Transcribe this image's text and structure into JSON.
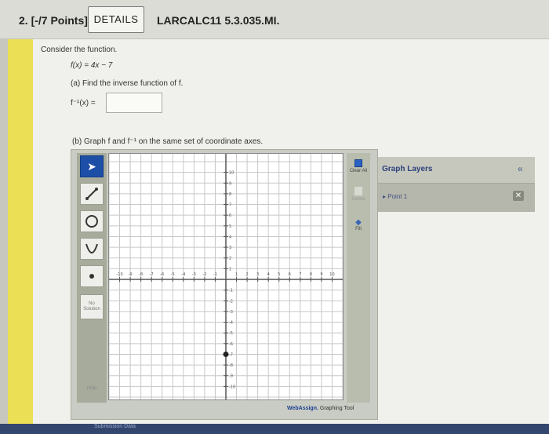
{
  "header": {
    "question_number": "2. [-/7 Points]",
    "details_label": "DETAILS",
    "problem_id": "LARCALC11 5.3.035.MI."
  },
  "problem": {
    "intro": "Consider the function.",
    "function": "f(x) = 4x − 7",
    "part_a": "(a) Find the inverse function of f.",
    "inverse_label": "f⁻¹(x) =",
    "inverse_value": "",
    "part_b": "(b) Graph f and f⁻¹ on the same set of coordinate axes."
  },
  "graph_tool": {
    "tools": [
      {
        "name": "pointer-tool",
        "icon": "arrow-icon"
      },
      {
        "name": "line-tool",
        "icon": "line-icon"
      },
      {
        "name": "circle-tool",
        "icon": "circle-icon"
      },
      {
        "name": "parabola-tool",
        "icon": "parabola-icon"
      },
      {
        "name": "point-tool",
        "icon": "point-icon"
      }
    ],
    "no_solution_label": "No Solution",
    "help_label": "Help",
    "clear_all_label": "Clear All",
    "delete_label": "Delete",
    "fill_label": "Fill",
    "brand_webassign": "WebAssign.",
    "brand_suffix": " Graphing Tool",
    "x_tick_labels": [
      "-10",
      "-9",
      "-8",
      "-7",
      "-6",
      "-5",
      "-4",
      "-3",
      "-2",
      "-1",
      "1",
      "2",
      "3",
      "4",
      "5",
      "6",
      "7",
      "8",
      "9",
      "10"
    ],
    "y_tick_labels": [
      "10",
      "9",
      "8",
      "7",
      "6",
      "5",
      "4",
      "3",
      "2",
      "1",
      "-1",
      "-2",
      "-3",
      "-4",
      "-5",
      "-6",
      "-7",
      "-8",
      "-9",
      "-10"
    ],
    "plotted_point": {
      "x": 0,
      "y": -7
    }
  },
  "layers": {
    "title": "Graph Layers",
    "collapse_symbol": "«",
    "items": [
      "Point 1"
    ],
    "delete_symbol": "✕"
  },
  "footer": {
    "link_text": "Submission Data"
  },
  "colors": {
    "accent_blue": "#1d4fa7",
    "yellow_bar": "#eadf55",
    "grid_line": "#c8c8c8",
    "axis": "#555555"
  }
}
